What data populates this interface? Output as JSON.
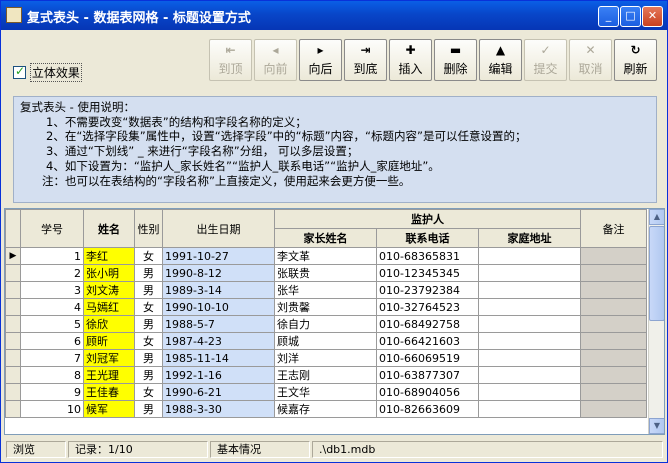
{
  "window": {
    "title": "复式表头 - 数据表网格 - 标题设置方式",
    "controls": [
      "_",
      "□",
      "✕"
    ]
  },
  "options": {
    "stereo_label": "立体效果",
    "stereo_checked": true
  },
  "toolbar": [
    {
      "label": "到顶",
      "icon": "⇤",
      "enabled": false
    },
    {
      "label": "向前",
      "icon": "◂",
      "enabled": false
    },
    {
      "label": "向后",
      "icon": "▸",
      "enabled": true
    },
    {
      "label": "到底",
      "icon": "⇥",
      "enabled": true
    },
    {
      "label": "插入",
      "icon": "✚",
      "enabled": true
    },
    {
      "label": "删除",
      "icon": "▬",
      "enabled": true
    },
    {
      "label": "编辑",
      "icon": "▲",
      "enabled": true
    },
    {
      "label": "提交",
      "icon": "✓",
      "enabled": false
    },
    {
      "label": "取消",
      "icon": "✕",
      "enabled": false
    },
    {
      "label": "刷新",
      "icon": "↻",
      "enabled": true
    }
  ],
  "notes": {
    "heading": "复式表头 - 使用说明：",
    "items": [
      "1、不需要改变“数据表”的结构和字段名称的定义；",
      "2、在“选择字段集”属性中，设置“选择字段”中的“标题”内容，“标题内容”是可以任意设置的；",
      "3、通过“下划线” _ 来进行“字段名称”分组， 可以多层设置；",
      "4、如下设置为：“监护人_家长姓名”“监护人_联系电话”“监护人_家庭地址”。"
    ],
    "footnote": "注：也可以在表结构的“字段名称”上直接定义，使用起来会更方便一些。"
  },
  "grid": {
    "headers": {
      "id": "学号",
      "name": "姓名",
      "gender": "性别",
      "birth": "出生日期",
      "guardian": "监护人",
      "parent": "家长姓名",
      "phone": "联系电话",
      "address": "家庭地址",
      "note": "备注"
    },
    "current_row_marker": "▶",
    "rows": [
      {
        "id": "1",
        "name": "李红",
        "gender": "女",
        "birth": "1991-10-27",
        "parent": "李文革",
        "phone": "010-68365831",
        "address": ""
      },
      {
        "id": "2",
        "name": "张小明",
        "gender": "男",
        "birth": "1990-8-12",
        "parent": "张联贵",
        "phone": "010-12345345",
        "address": ""
      },
      {
        "id": "3",
        "name": "刘文涛",
        "gender": "男",
        "birth": "1989-3-14",
        "parent": "张华",
        "phone": "010-23792384",
        "address": ""
      },
      {
        "id": "4",
        "name": "马嫣红",
        "gender": "女",
        "birth": "1990-10-10",
        "parent": "刘贵馨",
        "phone": "010-32764523",
        "address": ""
      },
      {
        "id": "5",
        "name": "徐欣",
        "gender": "男",
        "birth": "1988-5-7",
        "parent": "徐自力",
        "phone": "010-68492758",
        "address": ""
      },
      {
        "id": "6",
        "name": "顾昕",
        "gender": "女",
        "birth": "1987-4-23",
        "parent": "顾城",
        "phone": "010-66421603",
        "address": ""
      },
      {
        "id": "7",
        "name": "刘冠军",
        "gender": "男",
        "birth": "1985-11-14",
        "parent": "刘洋",
        "phone": "010-66069519",
        "address": ""
      },
      {
        "id": "8",
        "name": "王光理",
        "gender": "男",
        "birth": "1992-1-16",
        "parent": "王志刚",
        "phone": "010-63877307",
        "address": ""
      },
      {
        "id": "9",
        "name": "王佳春",
        "gender": "女",
        "birth": "1990-6-21",
        "parent": "王文华",
        "phone": "010-68904056",
        "address": ""
      },
      {
        "id": "10",
        "name": "候军",
        "gender": "男",
        "birth": "1988-3-30",
        "parent": "候嘉存",
        "phone": "010-82663609",
        "address": ""
      }
    ]
  },
  "status": {
    "mode": "浏览",
    "record": "记录：1/10",
    "table": "基本情况",
    "file": ".\\db1.mdb"
  }
}
